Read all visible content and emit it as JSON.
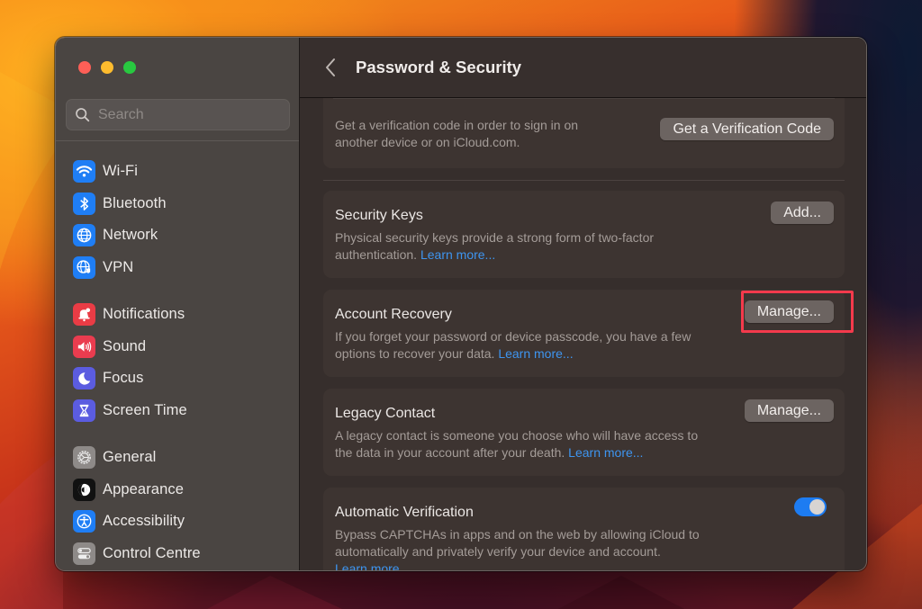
{
  "window": {
    "title": "Password & Security",
    "traffic_lights": [
      "close",
      "minimize",
      "maximize"
    ]
  },
  "sidebar": {
    "search": {
      "placeholder": "Search",
      "value": ""
    },
    "groups": [
      [
        {
          "label": "Wi-Fi",
          "icon": "wifi-icon",
          "color": "#1f7ef5"
        },
        {
          "label": "Bluetooth",
          "icon": "bluetooth-icon",
          "color": "#1f7ef5"
        },
        {
          "label": "Network",
          "icon": "globe-icon",
          "color": "#1f7ef5"
        },
        {
          "label": "VPN",
          "icon": "vpn-globe-shield-icon",
          "color": "#1f7ef5"
        }
      ],
      [
        {
          "label": "Notifications",
          "icon": "bell-icon",
          "color": "#ea3c45"
        },
        {
          "label": "Sound",
          "icon": "speaker-icon",
          "color": "#ea3c4f"
        },
        {
          "label": "Focus",
          "icon": "moon-icon",
          "color": "#5b5ce0"
        },
        {
          "label": "Screen Time",
          "icon": "hourglass-icon",
          "color": "#5b5ce0"
        }
      ],
      [
        {
          "label": "General",
          "icon": "gear-icon",
          "color": "#8e8a88"
        },
        {
          "label": "Appearance",
          "icon": "appearance-icon",
          "color": "#111111"
        },
        {
          "label": "Accessibility",
          "icon": "accessibility-icon",
          "color": "#1f7ef5"
        },
        {
          "label": "Control Centre",
          "icon": "toggles-icon",
          "color": "#8e8a88"
        }
      ]
    ]
  },
  "main": {
    "header": {
      "title": "Password & Security",
      "back_label": "Back"
    },
    "verification": {
      "description": "Get a verification code in order to sign in on another device or on iCloud.com.",
      "button": "Get a Verification Code"
    },
    "security_keys": {
      "title": "Security Keys",
      "description": "Physical security keys provide a strong form of two-factor authentication.",
      "link": "Learn more...",
      "button": "Add..."
    },
    "account_recovery": {
      "title": "Account Recovery",
      "description": "If you forget your password or device passcode, you have a few options to recover your data.",
      "link": "Learn more...",
      "button": "Manage...",
      "highlighted": true,
      "highlight_color": "#f43a4c"
    },
    "legacy_contact": {
      "title": "Legacy Contact",
      "description": "A legacy contact is someone you choose who will have access to the data in your account after your death.",
      "link": "Learn more...",
      "button": "Manage..."
    },
    "automatic_verification": {
      "title": "Automatic Verification",
      "description": "Bypass CAPTCHAs in apps and on the web by allowing iCloud to automatically and privately verify your device and account.",
      "link": "Learn more...",
      "toggle_on": true,
      "toggle_color": "#1d7cf2"
    }
  },
  "colors": {
    "accent": "#1d7cf2",
    "link": "#3e95f0",
    "highlight": "#f43a4c"
  }
}
